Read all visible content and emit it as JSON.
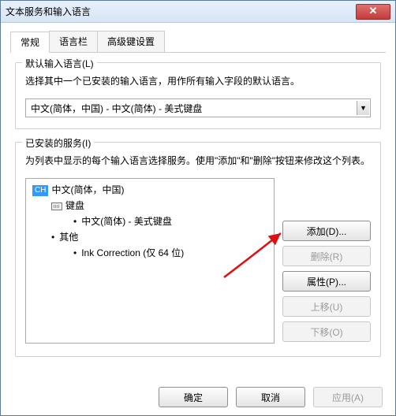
{
  "window": {
    "title": "文本服务和输入语言"
  },
  "tabs": [
    {
      "label": "常规",
      "active": true
    },
    {
      "label": "语言栏",
      "active": false
    },
    {
      "label": "高级键设置",
      "active": false
    }
  ],
  "default_lang": {
    "legend": "默认输入语言(L)",
    "desc": "选择其中一个已安装的输入语言，用作所有输入字段的默认语言。",
    "value": "中文(简体，中国) - 中文(简体) - 美式键盘"
  },
  "installed": {
    "legend": "已安装的服务(I)",
    "desc": "为列表中显示的每个输入语言选择服务。使用\"添加\"和\"删除\"按钮来修改这个列表。",
    "tree": {
      "root_badge": "CH",
      "root": "中文(简体，中国)",
      "keyboard_label": "键盘",
      "keyboard_item": "中文(简体) - 美式键盘",
      "other_label": "其他",
      "other_item": "Ink Correction (仅 64 位)"
    },
    "buttons": {
      "add": "添加(D)...",
      "remove": "删除(R)",
      "props": "属性(P)...",
      "moveup": "上移(U)",
      "movedown": "下移(O)"
    }
  },
  "footer": {
    "ok": "确定",
    "cancel": "取消",
    "apply": "应用(A)"
  }
}
